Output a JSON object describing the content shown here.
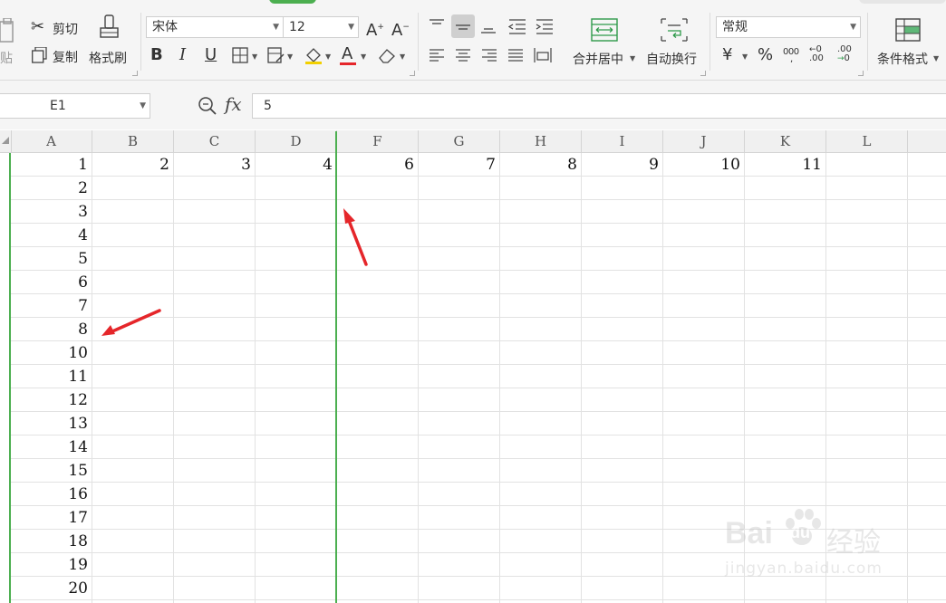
{
  "ribbon": {
    "paste_label": "贴",
    "cut_label": "剪切",
    "copy_label": "复制",
    "format_painter_label": "格式刷",
    "font_name": "宋体",
    "font_size": "12",
    "bold_label": "B",
    "italic_label": "I",
    "underline_label": "U",
    "font_color_label": "A",
    "merge_center_label": "合并居中",
    "wrap_text_label": "自动换行",
    "number_format": "常规",
    "currency_label": "¥",
    "percent_label": "%",
    "thousands_label": "000",
    "inc_decimal_label": ".00",
    "dec_decimal_label": ".00",
    "conditional_format_label": "条件格式"
  },
  "formula_bar": {
    "name_box": "E1",
    "fx_label": "fx",
    "value": "5"
  },
  "sheet": {
    "columns": [
      "A",
      "B",
      "C",
      "D",
      "F",
      "G",
      "H",
      "I",
      "J",
      "K",
      "L"
    ],
    "row1_values": [
      "1",
      "2",
      "3",
      "4",
      "6",
      "7",
      "8",
      "9",
      "10",
      "11"
    ],
    "col_a_values": [
      "2",
      "3",
      "4",
      "5",
      "6",
      "7",
      "8",
      "10",
      "11",
      "12",
      "13",
      "14",
      "15",
      "16",
      "17",
      "18",
      "19",
      "20"
    ]
  },
  "watermark": {
    "brand": "Bai",
    "brand2": "du",
    "cn": "经验",
    "url": "jingyan.baidu.com"
  },
  "colors": {
    "accent_green": "#4caf50",
    "arrow_red": "#e5262a"
  }
}
